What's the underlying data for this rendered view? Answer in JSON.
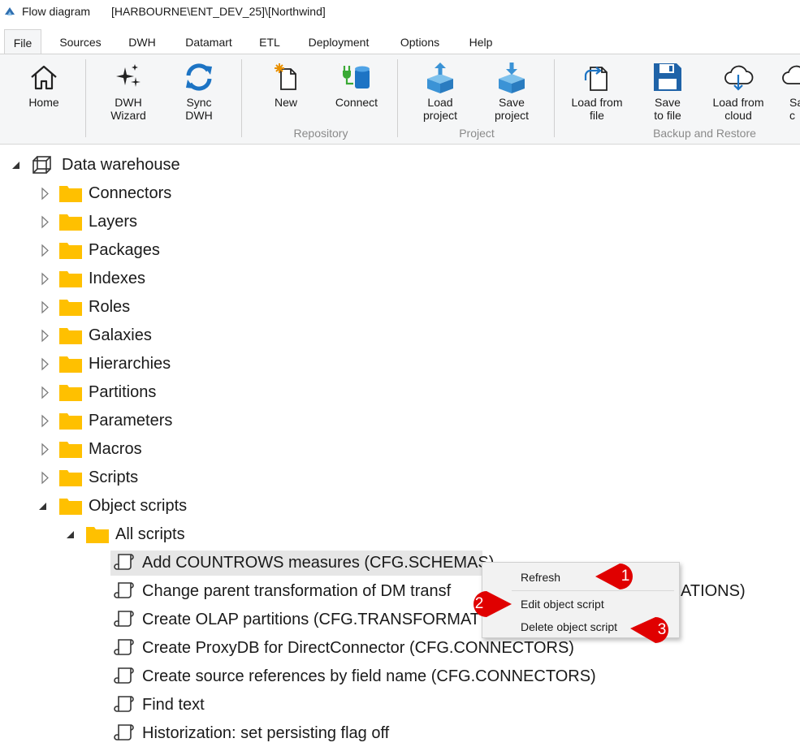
{
  "window": {
    "title": "Flow diagram",
    "context": "[HARBOURNE\\ENT_DEV_25]\\[Northwind]"
  },
  "tabs": [
    "File",
    "Sources",
    "DWH",
    "Datamart",
    "ETL",
    "Deployment",
    "Options",
    "Help"
  ],
  "active_tab": "File",
  "ribbon": {
    "home": [
      "Home"
    ],
    "dwh_wizard": [
      "DWH",
      "Wizard"
    ],
    "sync_dwh": [
      "Sync",
      "DWH"
    ],
    "new": [
      "New"
    ],
    "connect": [
      "Connect"
    ],
    "load_project": [
      "Load",
      "project"
    ],
    "save_project": [
      "Save",
      "project"
    ],
    "load_from_file": [
      "Load from",
      "file"
    ],
    "save_to_file": [
      "Save",
      "to file"
    ],
    "load_from_cloud": [
      "Load from",
      "cloud"
    ],
    "save_to_cloud": [
      "Sa",
      "c"
    ],
    "groups": {
      "repository": "Repository",
      "project": "Project",
      "backup": "Backup and Restore"
    }
  },
  "tree": {
    "root": "Data warehouse",
    "folders": [
      "Connectors",
      "Layers",
      "Packages",
      "Indexes",
      "Roles",
      "Galaxies",
      "Hierarchies",
      "Partitions",
      "Parameters",
      "Macros",
      "Scripts"
    ],
    "object_scripts": "Object scripts",
    "all_scripts": "All scripts",
    "scripts": [
      "Add COUNTROWS measures (CFG.SCHEMAS)",
      "Change parent transformation of DM transf",
      "Create OLAP partitions (CFG.TRANSFORMAT",
      "Create ProxyDB for DirectConnector (CFG.CONNECTORS)",
      "Create source references by field name (CFG.CONNECTORS)",
      "Find text",
      "Historization: set persisting flag off"
    ],
    "script_overflow_suffix": "ATIONS)"
  },
  "context_menu": {
    "items": [
      "Refresh",
      "Edit object script",
      "Delete object script"
    ]
  },
  "callouts": [
    "1",
    "2",
    "3"
  ],
  "colors": {
    "folder": "#ffc000",
    "callout": "#e00000",
    "ribbon_blue": "#1d74c4",
    "ribbon_bg": "#f5f6f7"
  }
}
